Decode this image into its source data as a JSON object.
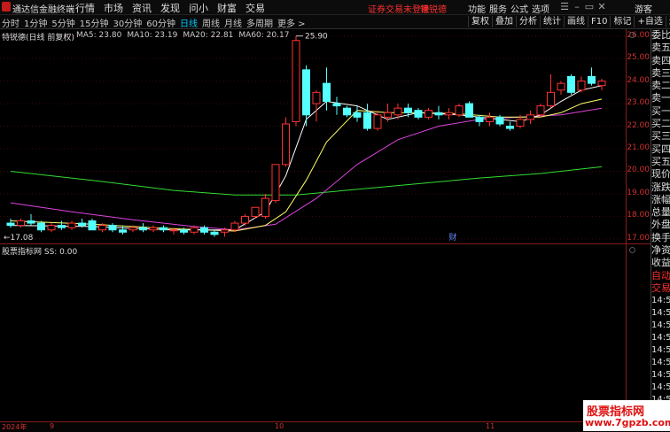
{
  "topbar": {
    "app_title": "通达信金融终端",
    "menu": [
      "行情",
      "市场",
      "资讯",
      "发现",
      "问小达",
      "财富圈",
      "交易"
    ],
    "notice": "证券交易未登录",
    "stock_link": "特锐德",
    "right_menu": [
      "功能",
      "服务",
      "公式",
      "选项"
    ],
    "guest": "游客",
    "brand_color": "#c41b1b"
  },
  "periods": {
    "items": [
      "分时",
      "1分钟",
      "5分钟",
      "15分钟",
      "30分钟",
      "60分钟",
      "日线",
      "周线",
      "月线",
      "多周期",
      "更多 >"
    ],
    "active": "日线"
  },
  "toolbar": [
    "复权",
    "叠加",
    "分析",
    "统计",
    "画线",
    "F10",
    "标记",
    "+自选",
    "返回"
  ],
  "main_pane": {
    "title": "特锐德(日线 前复权)",
    "ma": [
      {
        "label": "MA5: 23.80",
        "color": "#ffffff"
      },
      {
        "label": "MA10: 23.19",
        "color": "#ffff66"
      },
      {
        "label": "MA20: 22.81",
        "color": "#dd44dd"
      },
      {
        "label": "MA60: 20.17",
        "color": "#33dd33"
      }
    ],
    "yticks": [
      "26.00",
      "25.00",
      "24.00",
      "23.00",
      "22.00",
      "21.00",
      "20.00",
      "19.00",
      "18.00",
      "17.00"
    ],
    "high_label": "25.90",
    "low_label": "17.08",
    "fin_marker": "财"
  },
  "sub_pane": {
    "title": "股票指标网  SS: 0.00"
  },
  "dates": [
    "2024年",
    "9",
    "10",
    "11"
  ],
  "quote_panel": {
    "rows": [
      "委比",
      "卖五",
      "卖四",
      "卖三",
      "卖二",
      "卖一",
      "买一",
      "买二",
      "买三",
      "买四",
      "买五",
      "现价",
      "涨跌",
      "涨幅",
      "总量",
      "外盘",
      "换手",
      "净资",
      "收益"
    ],
    "header2": "自动",
    "header3": "交易",
    "times": [
      "14:5",
      "14:5",
      "14:5",
      "14:5",
      "14:5",
      "14:5",
      "14:5",
      "14:5",
      "14:5",
      "14:5",
      "14:5",
      "14:5"
    ]
  },
  "watermark": {
    "line1": "股票指标网",
    "line2": "www.7gpzb.com"
  },
  "chart_data": {
    "type": "candlestick",
    "title": "特锐德(日线 前复权)",
    "ylim": [
      16.8,
      26.3
    ],
    "up_color": "#ff3232",
    "down_color": "#54ffff",
    "candles": [
      [
        17.7,
        17.9,
        17.5,
        17.6
      ],
      [
        17.6,
        17.9,
        17.5,
        17.8
      ],
      [
        17.8,
        18.1,
        17.6,
        17.7
      ],
      [
        17.7,
        17.8,
        17.3,
        17.4
      ],
      [
        17.4,
        17.7,
        17.3,
        17.6
      ],
      [
        17.6,
        17.8,
        17.4,
        17.5
      ],
      [
        17.5,
        17.8,
        17.4,
        17.7
      ],
      [
        17.7,
        17.9,
        17.5,
        17.6
      ],
      [
        17.8,
        17.9,
        17.4,
        17.4
      ],
      [
        17.4,
        17.7,
        17.3,
        17.6
      ],
      [
        17.6,
        17.7,
        17.3,
        17.4
      ],
      [
        17.4,
        17.6,
        17.2,
        17.3
      ],
      [
        17.4,
        17.6,
        17.3,
        17.5
      ],
      [
        17.5,
        17.7,
        17.3,
        17.4
      ],
      [
        17.4,
        17.6,
        17.3,
        17.5
      ],
      [
        17.5,
        17.6,
        17.3,
        17.4
      ],
      [
        17.4,
        17.5,
        17.2,
        17.4
      ],
      [
        17.4,
        17.5,
        17.2,
        17.3
      ],
      [
        17.3,
        17.6,
        17.2,
        17.5
      ],
      [
        17.5,
        17.6,
        17.2,
        17.3
      ],
      [
        17.3,
        17.4,
        17.1,
        17.2
      ],
      [
        17.3,
        17.5,
        17.1,
        17.4
      ],
      [
        17.4,
        17.8,
        17.3,
        17.7
      ],
      [
        17.7,
        18.1,
        17.6,
        18.0
      ],
      [
        18.0,
        18.4,
        17.9,
        18.4
      ],
      [
        18.0,
        19.0,
        17.9,
        18.8
      ],
      [
        18.7,
        20.3,
        18.6,
        20.3
      ],
      [
        20.3,
        22.4,
        20.2,
        22.1
      ],
      [
        22.2,
        26.0,
        22.0,
        25.8
      ],
      [
        24.5,
        24.7,
        22.0,
        22.5
      ],
      [
        23.0,
        23.6,
        22.2,
        23.5
      ],
      [
        23.9,
        24.6,
        22.7,
        23.1
      ],
      [
        23.0,
        23.3,
        22.5,
        22.9
      ],
      [
        22.8,
        22.9,
        22.4,
        22.5
      ],
      [
        22.6,
        22.9,
        22.2,
        22.4
      ],
      [
        22.6,
        23.0,
        21.8,
        21.9
      ],
      [
        21.9,
        22.7,
        21.8,
        22.5
      ],
      [
        22.4,
        23.0,
        22.2,
        22.6
      ],
      [
        22.5,
        23.0,
        22.3,
        22.8
      ],
      [
        22.8,
        23.0,
        22.4,
        22.6
      ],
      [
        22.7,
        22.8,
        22.3,
        22.4
      ],
      [
        22.4,
        22.8,
        22.3,
        22.7
      ],
      [
        22.6,
        22.9,
        22.3,
        22.5
      ],
      [
        22.5,
        22.8,
        22.3,
        22.6
      ],
      [
        22.5,
        23.0,
        22.4,
        22.9
      ],
      [
        23.0,
        23.1,
        22.4,
        22.4
      ],
      [
        22.4,
        22.5,
        22.0,
        22.2
      ],
      [
        22.2,
        22.6,
        22.0,
        22.4
      ],
      [
        22.4,
        22.5,
        22.0,
        22.1
      ],
      [
        22.0,
        22.2,
        21.8,
        21.9
      ],
      [
        22.0,
        22.5,
        21.9,
        22.3
      ],
      [
        22.3,
        22.7,
        22.1,
        22.5
      ],
      [
        22.5,
        23.0,
        22.4,
        22.9
      ],
      [
        22.9,
        24.3,
        22.8,
        23.5
      ],
      [
        23.6,
        24.0,
        23.4,
        23.9
      ],
      [
        24.2,
        24.3,
        23.4,
        23.5
      ],
      [
        23.6,
        24.2,
        23.5,
        24.0
      ],
      [
        24.2,
        24.6,
        23.8,
        23.9
      ],
      [
        23.8,
        24.1,
        23.6,
        24.0
      ]
    ],
    "ma5": [
      [
        0,
        17.6
      ],
      [
        8,
        17.55
      ],
      [
        16,
        17.4
      ],
      [
        22,
        17.4
      ],
      [
        25,
        18.2
      ],
      [
        27,
        19.8
      ],
      [
        29,
        22.3
      ],
      [
        31,
        23.1
      ],
      [
        34,
        22.9
      ],
      [
        37,
        22.3
      ],
      [
        40,
        22.6
      ],
      [
        44,
        22.5
      ],
      [
        48,
        22.3
      ],
      [
        50,
        22.2
      ],
      [
        52,
        22.5
      ],
      [
        54,
        23.1
      ],
      [
        56,
        23.6
      ],
      [
        58,
        23.8
      ]
    ],
    "ma10": [
      [
        0,
        17.8
      ],
      [
        8,
        17.65
      ],
      [
        16,
        17.45
      ],
      [
        22,
        17.35
      ],
      [
        25,
        17.6
      ],
      [
        27,
        18.2
      ],
      [
        29,
        19.6
      ],
      [
        31,
        21.3
      ],
      [
        34,
        22.7
      ],
      [
        37,
        22.6
      ],
      [
        40,
        22.6
      ],
      [
        44,
        22.55
      ],
      [
        48,
        22.4
      ],
      [
        52,
        22.4
      ],
      [
        54,
        22.6
      ],
      [
        56,
        23.0
      ],
      [
        58,
        23.2
      ]
    ],
    "ma20": [
      [
        0,
        18.6
      ],
      [
        6,
        18.2
      ],
      [
        12,
        17.85
      ],
      [
        18,
        17.55
      ],
      [
        22,
        17.4
      ],
      [
        26,
        17.65
      ],
      [
        30,
        18.8
      ],
      [
        34,
        20.3
      ],
      [
        38,
        21.4
      ],
      [
        42,
        22.0
      ],
      [
        46,
        22.3
      ],
      [
        50,
        22.4
      ],
      [
        54,
        22.5
      ],
      [
        58,
        22.8
      ]
    ],
    "ma60": [
      [
        0,
        20.0
      ],
      [
        8,
        19.6
      ],
      [
        16,
        19.15
      ],
      [
        22,
        18.95
      ],
      [
        28,
        18.95
      ],
      [
        34,
        19.2
      ],
      [
        40,
        19.45
      ],
      [
        46,
        19.7
      ],
      [
        52,
        19.9
      ],
      [
        58,
        20.2
      ]
    ]
  }
}
